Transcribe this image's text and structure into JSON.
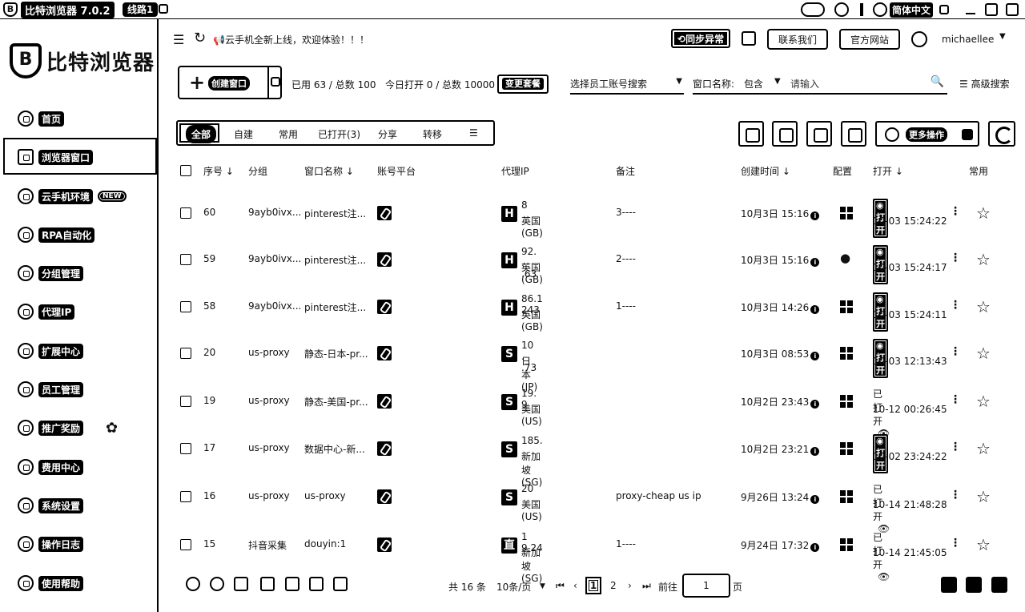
{
  "titlebar": {
    "logo_letter": "B",
    "app_title": "比特浏览器 7.0.2",
    "line_label": "线路1",
    "lang_label": "简体中文"
  },
  "sidebar": {
    "brand_letter": "B",
    "brand_text": "比特浏览器",
    "items": [
      {
        "label": "首页",
        "icon": "home-icon"
      },
      {
        "label": "浏览器窗口",
        "icon": "grid-icon"
      },
      {
        "label": "云手机环境",
        "icon": "cloud-icon",
        "badge": "NEW"
      },
      {
        "label": "RPA自动化",
        "icon": "robot-icon"
      },
      {
        "label": "分组管理",
        "icon": "layers-icon"
      },
      {
        "label": "代理IP",
        "icon": "globe-icon"
      },
      {
        "label": "扩展中心",
        "icon": "puzzle-icon"
      },
      {
        "label": "员工管理",
        "icon": "user-icon"
      },
      {
        "label": "推广奖励",
        "icon": "gift-icon"
      },
      {
        "label": "费用中心",
        "icon": "shield-icon"
      },
      {
        "label": "系统设置",
        "icon": "gear-icon"
      },
      {
        "label": "操作日志",
        "icon": "log-icon"
      },
      {
        "label": "使用帮助",
        "icon": "help-icon"
      }
    ]
  },
  "topbar": {
    "notice": "云手机全新上线，欢迎体验！！！",
    "sync_label": "同步异常",
    "contact_label": "联系我们",
    "website_label": "官方网站",
    "username": "michaellee"
  },
  "toolbar": {
    "create_label": "创建窗口",
    "usage": "已用 63 / 总数 100",
    "today_open": "今日打开 0 / 总数 10000",
    "plan_label": "变更套餐",
    "employee_select": "选择员工账号搜索",
    "name_filter_label": "窗口名称:",
    "name_filter_mode": "包含",
    "name_filter_placeholder": "请输入",
    "advanced_label": "高级搜索"
  },
  "tabs": [
    "全部",
    "自建",
    "常用",
    "已打开(3)",
    "分享",
    "转移"
  ],
  "actions": {
    "more_label": "更多操作"
  },
  "table": {
    "headers": [
      "序号",
      "分组",
      "窗口名称",
      "账号平台",
      "代理IP",
      "备注",
      "创建时间",
      "配置",
      "打开",
      "常用"
    ],
    "open_label": "打开",
    "opened_label": "已打开",
    "rows": [
      {
        "seq": "60",
        "pin": true,
        "group": "9ayb0ivx...",
        "name": "pinterest注...",
        "ptype": "H",
        "ip": "8",
        "loc": "英国(GB)",
        "note": "3----",
        "created": "10月3日 15:16",
        "os": "windows",
        "open": "button",
        "open_time": "10-03 15:24:22"
      },
      {
        "seq": "59",
        "pin": true,
        "group": "9ayb0ivx...",
        "name": "pinterest注...",
        "ptype": "H",
        "ip": "92.  .  .63",
        "loc": "英国(GB)",
        "note": "2----",
        "created": "10月3日 15:16",
        "os": "mac",
        "open": "button",
        "open_time": "10-03 15:24:17"
      },
      {
        "seq": "58",
        "pin": true,
        "group": "9ayb0ivx...",
        "name": "pinterest注...",
        "ptype": "H",
        "ip": "86.1      243",
        "loc": "英国(GB)",
        "note": "1----",
        "created": "10月3日 14:26",
        "os": "windows",
        "open": "button",
        "open_time": "10-03 15:24:11"
      },
      {
        "seq": "20",
        "pin": false,
        "group": "us-proxy",
        "name": "静态-日本-pr...",
        "ptype": "S",
        "ip": "10 .  . .73",
        "loc": "日本(JP)",
        "note": "",
        "created": "10月3日 08:53",
        "os": "windows",
        "open": "button",
        "open_time": "10-03 12:13:43"
      },
      {
        "seq": "19",
        "pin": false,
        "group": "us-proxy",
        "name": "静态-美国-pr...",
        "ptype": "S",
        "ip": "19.         9",
        "loc": "美国(US)",
        "note": "",
        "created": "10月2日 23:43",
        "os": "windows",
        "open": "opened",
        "open_time": "10-12 00:26:45"
      },
      {
        "seq": "17",
        "pin": false,
        "group": "us-proxy",
        "name": "数据中心-新...",
        "ptype": "S",
        "ip": "185.",
        "loc": "新加坡 (SG)",
        "note": "",
        "created": "10月2日 23:21",
        "os": "windows",
        "open": "button",
        "open_time": "10-02 23:24:22"
      },
      {
        "seq": "16",
        "pin": false,
        "group": "us-proxy",
        "name": "us-proxy",
        "ptype": "S",
        "ip": "20",
        "loc": "美国(US)",
        "note": "proxy-cheap us ip",
        "created": "9月26日 13:24",
        "os": "windows",
        "open": "opened",
        "open_time": "10-14 21:48:28"
      },
      {
        "seq": "15",
        "pin": false,
        "group": "抖音采集",
        "name": "douyin:1",
        "ptype": "直",
        "ip": "1      9.24",
        "loc": "新加坡 (SG)",
        "note": "1----",
        "created": "9月24日 17:32",
        "os": "windows",
        "open": "opened",
        "open_time": "10-14 21:45:05"
      }
    ]
  },
  "footer": {
    "total": "共 16 条",
    "per_page": "10条/页",
    "pages": [
      "1",
      "2"
    ],
    "goto_label": "前往",
    "goto_value": "1",
    "page_unit": "页"
  }
}
